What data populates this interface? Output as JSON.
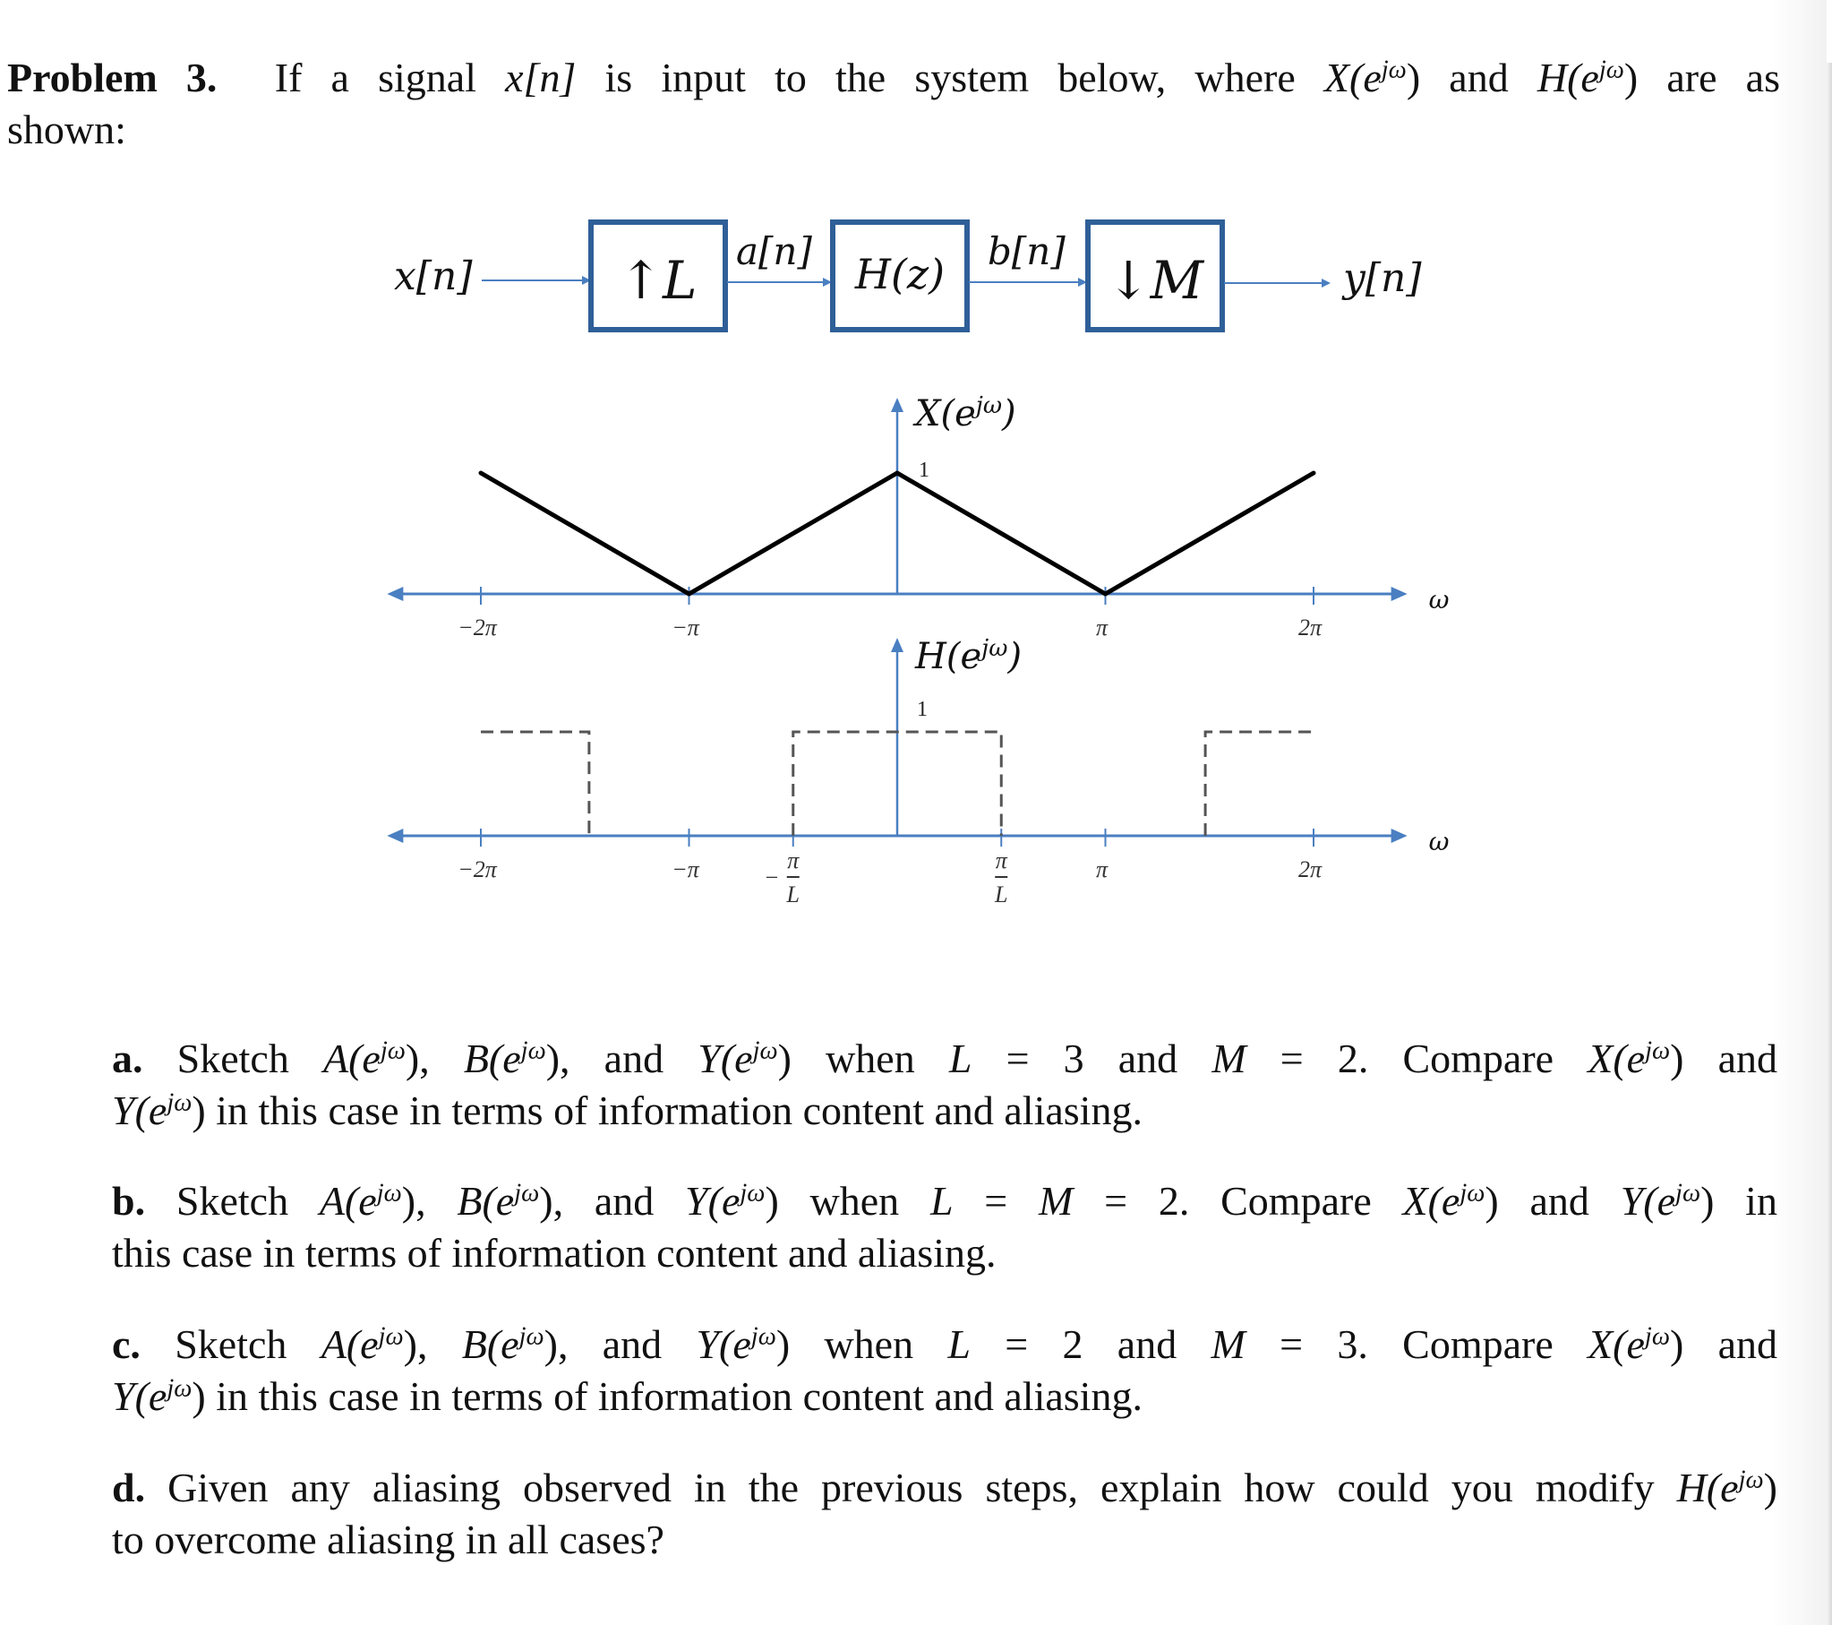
{
  "problem": {
    "heading": "Problem 3.",
    "intro_line1_pre": "If a signal ",
    "intro_signal": "x[n]",
    "intro_line1_mid": " is input to the system below, where ",
    "intro_X": "X(e",
    "intro_and": ") and ",
    "intro_H": "H(e",
    "intro_end": ") are as",
    "intro_line2": "shown:",
    "sup": "jω"
  },
  "block_diagram": {
    "input": "x[n]",
    "blocks": [
      {
        "label": "↑L",
        "name": "upsampler"
      },
      {
        "label": "H(z)",
        "name": "filter"
      },
      {
        "label": "↓M",
        "name": "downsampler"
      }
    ],
    "signals": [
      "a[n]",
      "b[n]"
    ],
    "output": "y[n]",
    "colors": {
      "box": "#2f5f98",
      "arrow": "#4a7fc1"
    }
  },
  "chart_data": [
    {
      "type": "line",
      "title": "X(e^{jω})",
      "ylabel": "X(e^{jω})",
      "xlabel": "ω",
      "x_unit": "π",
      "x": [
        -2,
        -1,
        0,
        1,
        2
      ],
      "y": [
        1,
        0,
        1,
        0,
        1
      ],
      "peak_label": "1",
      "xticks": [
        {
          "value": -2,
          "label": "−2π"
        },
        {
          "value": -1,
          "label": "−π"
        },
        {
          "value": 1,
          "label": "π"
        },
        {
          "value": 2,
          "label": "2π"
        }
      ],
      "xlim": [
        -2.45,
        2.45
      ],
      "ylim": [
        0,
        1
      ],
      "line_color": "#000000",
      "axis_color": "#4a7fc1"
    },
    {
      "type": "line",
      "title": "H(e^{jω})",
      "ylabel": "H(e^{jω})",
      "xlabel": "ω",
      "x_unit": "π",
      "style": "dashed",
      "segments": [
        {
          "x": [
            -2,
            -1.48,
            -1.48
          ],
          "y": [
            1,
            1,
            0
          ]
        },
        {
          "x": [
            -0.5,
            -0.5,
            0.5,
            0.5
          ],
          "y": [
            0,
            1,
            1,
            0
          ]
        },
        {
          "x": [
            1.48,
            1.48,
            2
          ],
          "y": [
            0,
            1,
            1
          ]
        }
      ],
      "level_label": "1",
      "xticks": [
        {
          "value": -2,
          "label": "−2π"
        },
        {
          "value": -1,
          "label": "−π"
        },
        {
          "value": -0.5,
          "label_num": "π",
          "label_den": "L",
          "sign": "−"
        },
        {
          "value": 0.5,
          "label_num": "π",
          "label_den": "L",
          "sign": ""
        },
        {
          "value": 1,
          "label": "π"
        },
        {
          "value": 2,
          "label": "2π"
        }
      ],
      "xlim": [
        -2.45,
        2.45
      ],
      "ylim": [
        0,
        1
      ],
      "line_color": "#666666",
      "axis_color": "#4a7fc1"
    }
  ],
  "questions": [
    {
      "label": "a.",
      "line1": [
        "Sketch ",
        "A(e",
        "jω",
        "), ",
        "B(e",
        "jω",
        "), and ",
        "Y(e",
        "jω",
        ") when ",
        "L",
        " = 3 and ",
        "M",
        " = 2.  Compare ",
        "X(e",
        "jω",
        ") and"
      ],
      "line2": [
        "Y(e",
        "jω",
        ") in this case in terms of information content and aliasing."
      ]
    },
    {
      "label": "b.",
      "line1": [
        "Sketch ",
        "A(e",
        "jω",
        "), ",
        "B(e",
        "jω",
        "), and ",
        "Y(e",
        "jω",
        ") when ",
        "L",
        " = ",
        "M",
        " = 2. Compare ",
        "X(e",
        "jω",
        ") and ",
        "Y(e",
        "jω",
        ") in"
      ],
      "line2": [
        "this case in terms of information content and aliasing."
      ]
    },
    {
      "label": "c.",
      "line1": [
        "Sketch ",
        "A(e",
        "jω",
        "), ",
        "B(e",
        "jω",
        "), and ",
        "Y(e",
        "jω",
        ") when ",
        "L",
        " = 2 and ",
        "M",
        " = 3.  Compare ",
        "X(e",
        "jω",
        ") and"
      ],
      "line2": [
        "Y(e",
        "jω",
        ") in this case in terms of information content and aliasing."
      ]
    },
    {
      "label": "d.",
      "line1": [
        "Given any aliasing observed in the previous steps, explain how could you modify ",
        "H(e",
        "jω",
        ")"
      ],
      "line2": [
        "to overcome aliasing in all cases?"
      ]
    }
  ]
}
